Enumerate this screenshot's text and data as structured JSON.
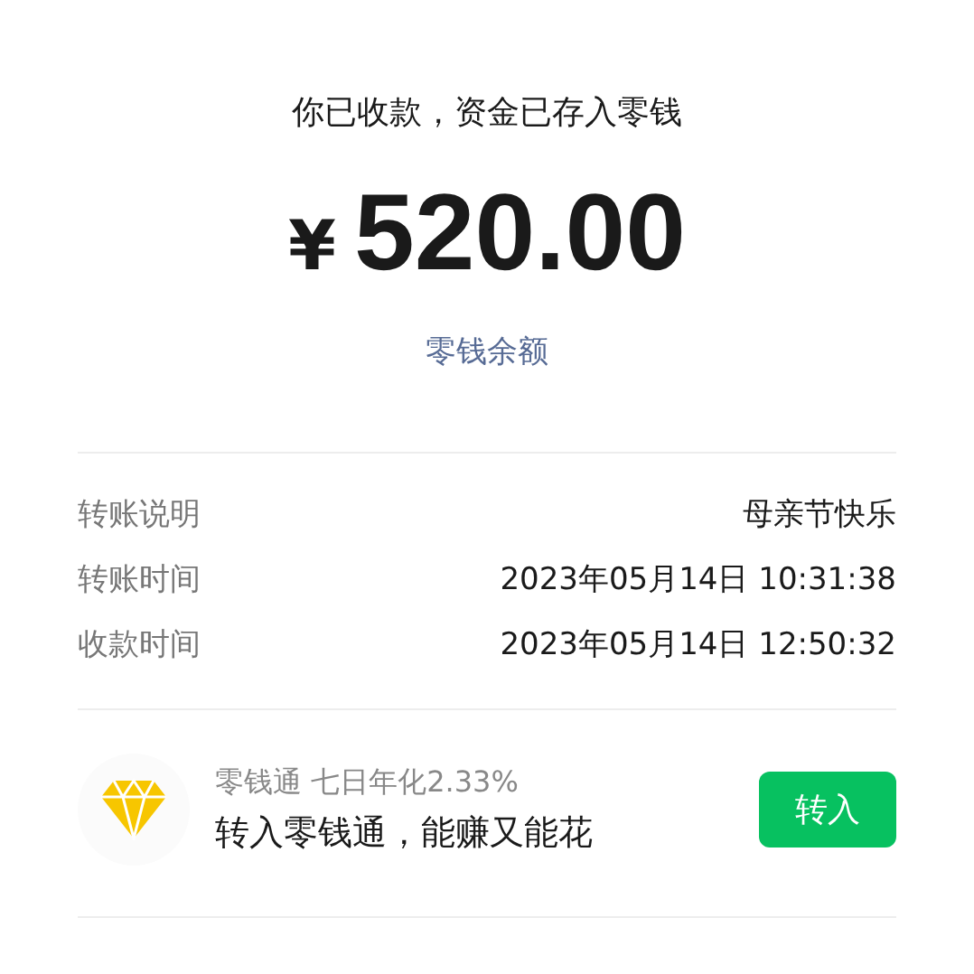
{
  "header": {
    "status": "你已收款，资金已存入零钱",
    "currency": "¥",
    "amount": "520.00",
    "link": "零钱余额"
  },
  "details": [
    {
      "label": "转账说明",
      "value": "母亲节快乐"
    },
    {
      "label": "转账时间",
      "value": "2023年05月14日 10:31:38"
    },
    {
      "label": "收款时间",
      "value": "2023年05月14日 12:50:32"
    }
  ],
  "promo": {
    "title": "零钱通 七日年化2.33%",
    "subtitle": "转入零钱通，能赚又能花",
    "button": "转入"
  }
}
